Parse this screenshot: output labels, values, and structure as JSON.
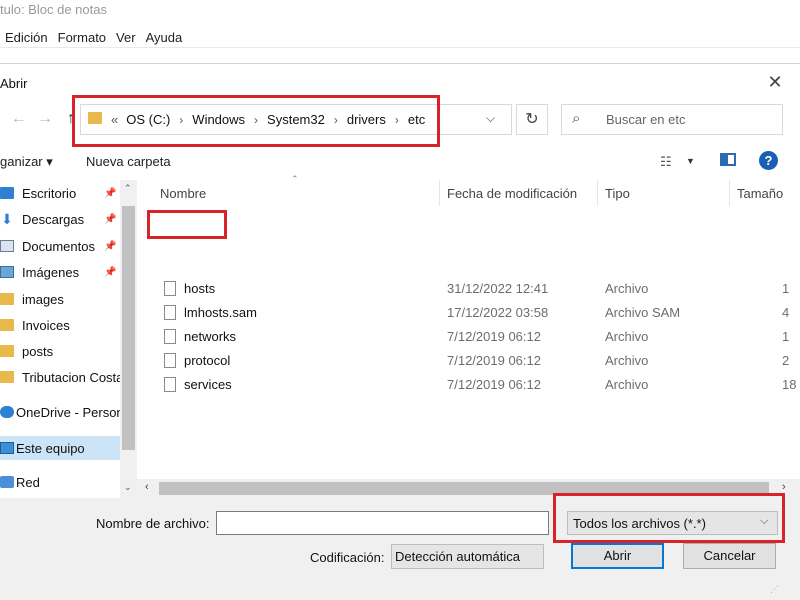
{
  "notepad": {
    "title_fragment": "tulo: Bloc de notas",
    "menu": [
      "Edición",
      "Formato",
      "Ver",
      "Ayuda"
    ]
  },
  "dialog": {
    "title": "Abrir",
    "close_glyph": "✕",
    "nav": {
      "back": "→",
      "forward": "→",
      "up": "↑"
    },
    "address": {
      "overflow": "«",
      "breadcrumbs": [
        "OS (C:)",
        "Windows",
        "System32",
        "drivers",
        "etc"
      ],
      "chevron": "⌵"
    },
    "refresh_glyph": "↻",
    "search": {
      "placeholder": "Buscar en etc",
      "icon": "search-icon"
    },
    "toolbar": {
      "organize": "ganizar ▾",
      "new_folder": "Nueva carpeta",
      "view_icon": "view-options-icon",
      "help": "?"
    },
    "sidebar": {
      "items": [
        {
          "label": "Escritorio",
          "icon": "desktop-icon",
          "pinned": true
        },
        {
          "label": "Descargas",
          "icon": "download-icon",
          "pinned": true
        },
        {
          "label": "Documentos",
          "icon": "documents-icon",
          "pinned": true
        },
        {
          "label": "Imágenes",
          "icon": "pictures-icon",
          "pinned": true
        },
        {
          "label": "images",
          "icon": "folder-icon",
          "pinned": false
        },
        {
          "label": "Invoices",
          "icon": "folder-icon",
          "pinned": false
        },
        {
          "label": "posts",
          "icon": "folder-icon",
          "pinned": false
        },
        {
          "label": "Tributacion Costa",
          "icon": "folder-icon",
          "pinned": false
        },
        {
          "label": "OneDrive - Person",
          "icon": "onedrive-icon",
          "pinned": false
        },
        {
          "label": "Este equipo",
          "icon": "computer-icon",
          "pinned": false,
          "selected": true
        },
        {
          "label": "Red",
          "icon": "network-icon",
          "pinned": false
        }
      ]
    },
    "file_list": {
      "columns": [
        "Nombre",
        "Fecha de modificación",
        "Tipo",
        "Tamaño"
      ],
      "rows": [
        {
          "name": "hosts",
          "date": "31/12/2022 12:41",
          "type": "Archivo",
          "size": "1"
        },
        {
          "name": "lmhosts.sam",
          "date": "17/12/2022 03:58",
          "type": "Archivo SAM",
          "size": "4"
        },
        {
          "name": "networks",
          "date": "7/12/2019 06:12",
          "type": "Archivo",
          "size": "1"
        },
        {
          "name": "protocol",
          "date": "7/12/2019 06:12",
          "type": "Archivo",
          "size": "2"
        },
        {
          "name": "services",
          "date": "7/12/2019 06:12",
          "type": "Archivo",
          "size": "18"
        }
      ]
    },
    "bottom": {
      "filename_label": "Nombre de archivo:",
      "filename_value": "",
      "file_type": "Todos los archivos  (*.*)",
      "encoding_label": "Codificación:",
      "encoding_value": "Detección automática",
      "open_button": "Abrir",
      "cancel_button": "Cancelar"
    }
  },
  "colors": {
    "highlight": "#d8232a",
    "accent": "#0078d7",
    "selection": "#cce4f7"
  }
}
